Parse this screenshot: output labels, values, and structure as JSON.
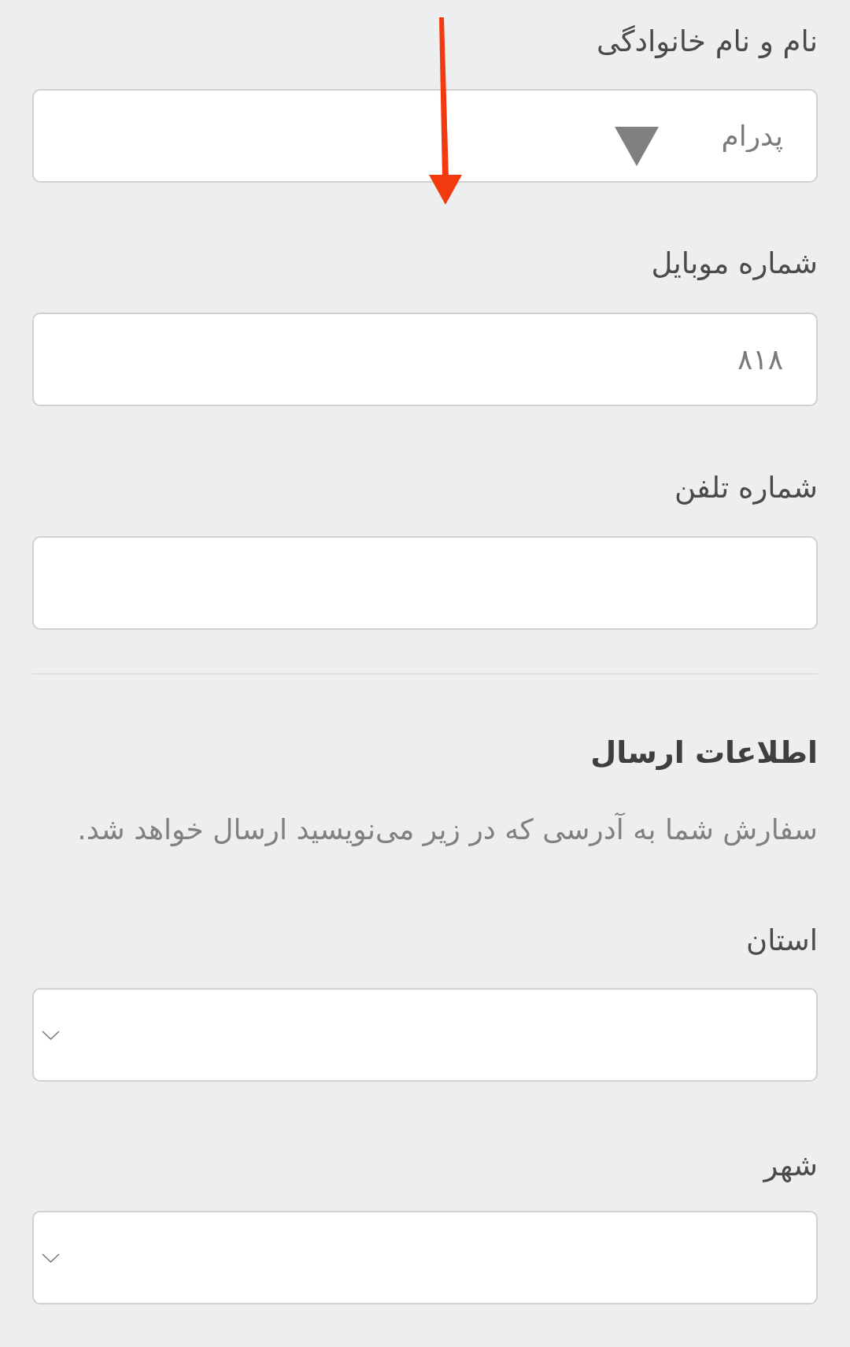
{
  "contact_fields": [
    {
      "label": "نام و نام خانوادگی",
      "kind": "text",
      "value": "پدرام"
    },
    {
      "label": "شماره موبایل",
      "kind": "text",
      "value": "۸۱۸"
    },
    {
      "label": "شماره تلفن",
      "kind": "text"
    }
  ],
  "shipping": {
    "title": "اطلاعات ارسال",
    "description": "سفارش شما به آدرسی که در زیر می‌نویسید ارسال خواهد شد.",
    "fields": [
      {
        "label": "استان",
        "kind": "select"
      },
      {
        "label": "شهر",
        "kind": "select"
      }
    ]
  }
}
